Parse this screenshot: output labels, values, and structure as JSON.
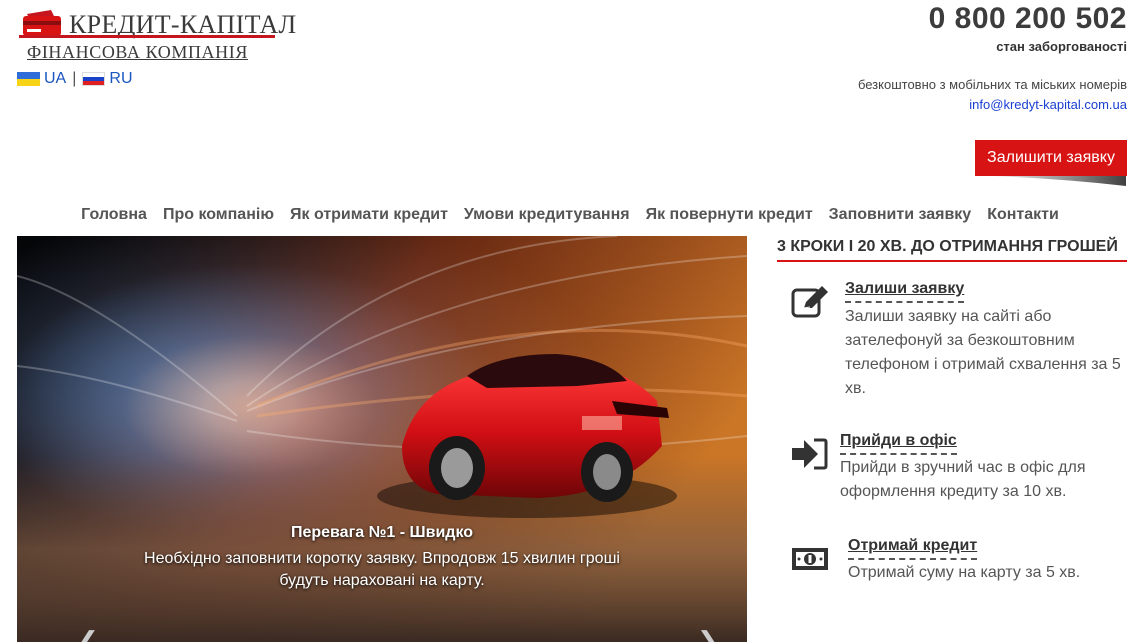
{
  "brand": {
    "title": "КРЕДИТ-КАПІТАЛ",
    "subtitle": "ФІНАНСОВА КОМПАНІЯ",
    "accent_color": "#c4161c"
  },
  "languages": [
    {
      "code": "UA",
      "icon": "ukraine-flag-icon"
    },
    {
      "code": "RU",
      "icon": "russia-flag-icon"
    }
  ],
  "language_separator": "|",
  "contact": {
    "phone": "0 800 200 502",
    "phone_note": "стан заборгованості",
    "free_note": "безкоштовно з мобільних та міських номерів",
    "email": "info@kredyt-kapital.com.ua"
  },
  "cta": {
    "label": "Залишити заявку",
    "color": "#d81313"
  },
  "nav": [
    "Головна",
    "Про компанію",
    "Як отримати кредит",
    "Умови кредитування",
    "Як повернути кредит",
    "Заповнити заявку",
    "Контакти"
  ],
  "slider": {
    "prev_icon": "chevron-left-icon",
    "next_icon": "chevron-right-icon",
    "prev_glyph": "❮",
    "next_glyph": "❯",
    "caption_title": "Перевага №1 - Швидко",
    "caption_text": "Необхідно заповнити коротку заявку. Впродовж 15 хвилин гроші будуть нараховані на карту."
  },
  "steps": {
    "heading": "3 КРОКИ І 20 ХВ. ДО ОТРИМАННЯ ГРОШЕЙ",
    "items": [
      {
        "icon": "edit-form-icon",
        "title": "Залиши заявку",
        "text": "Залиши заявку на сайті або зателефонуй за безкоштовним телефоном і отримай схвалення за 5 хв."
      },
      {
        "icon": "sign-in-arrow-icon",
        "title": "Прийди в офіс",
        "text": "Прийди в зручний час в офіс для оформлення кредиту за 10 хв."
      },
      {
        "icon": "money-bill-icon",
        "title": "Отримай кредит",
        "text": "Отримай суму на карту за 5 хв."
      }
    ]
  }
}
